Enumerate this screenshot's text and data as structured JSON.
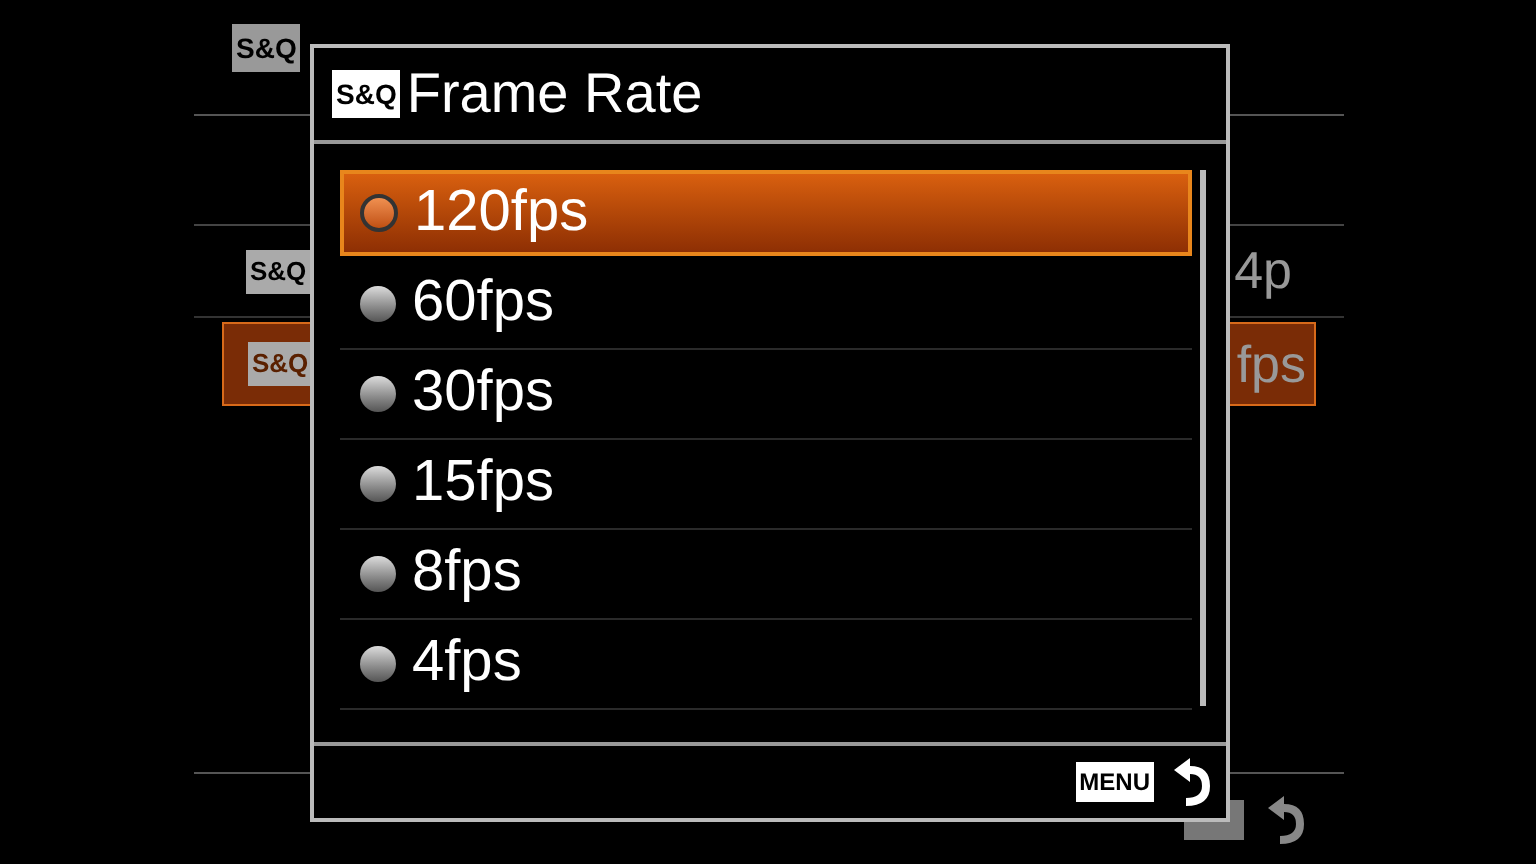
{
  "background": {
    "title_badge": "S&Q",
    "rows": [
      {
        "badge": "S&Q",
        "value": "4p",
        "selected": false
      },
      {
        "badge": "S&Q",
        "value": "fps",
        "selected": true
      }
    ]
  },
  "dialog": {
    "title_badge": "S&Q",
    "title": "Frame Rate",
    "options": [
      {
        "label": "120fps",
        "selected": true
      },
      {
        "label": "60fps",
        "selected": false
      },
      {
        "label": "30fps",
        "selected": false
      },
      {
        "label": "15fps",
        "selected": false
      },
      {
        "label": "8fps",
        "selected": false
      },
      {
        "label": "4fps",
        "selected": false
      }
    ],
    "footer_badge": "MENU"
  }
}
